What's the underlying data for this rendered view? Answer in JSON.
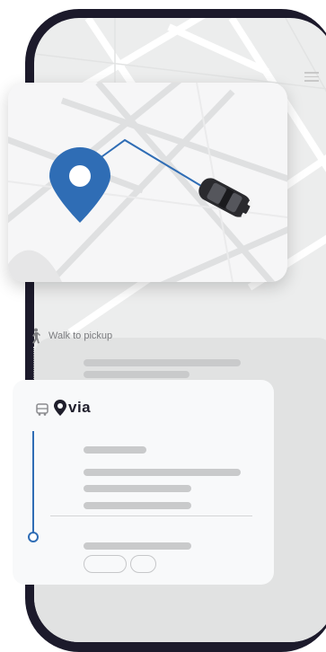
{
  "walk": {
    "label": "Walk to pickup",
    "icon": "walking-person-icon"
  },
  "brand": {
    "name": "via",
    "icon": "via-pin-logo-icon"
  },
  "icons": {
    "menu": "menu-icon",
    "bus": "bus-icon",
    "pin": "location-pin-icon",
    "car": "car-icon"
  },
  "colors": {
    "accent": "#2f6db5",
    "frame": "#1c1a2b",
    "brand_text": "#1f1e2b"
  }
}
